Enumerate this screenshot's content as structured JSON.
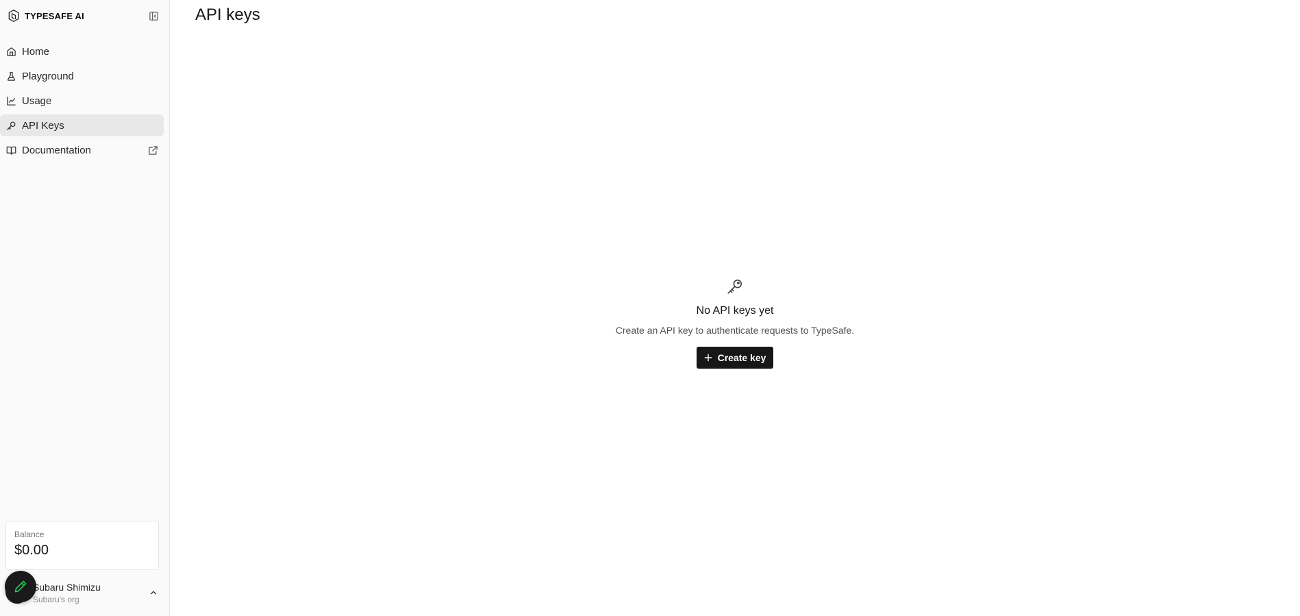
{
  "brand": {
    "name": "TYPESAFE AI",
    "logo_icon": "hexagon-logo-icon",
    "collapse_icon": "sidebar-collapse-icon"
  },
  "sidebar": {
    "items": [
      {
        "label": "Home",
        "icon": "home-icon",
        "active": false
      },
      {
        "label": "Playground",
        "icon": "flask-icon",
        "active": false
      },
      {
        "label": "Usage",
        "icon": "line-chart-icon",
        "active": false
      },
      {
        "label": "API Keys",
        "icon": "key-icon",
        "active": true
      },
      {
        "label": "Documentation",
        "icon": "book-icon",
        "active": false,
        "external": true
      }
    ]
  },
  "balance": {
    "label": "Balance",
    "value": "$0.00"
  },
  "user": {
    "name": "Subaru Shimizu",
    "org": "Subaru's org"
  },
  "main": {
    "title": "API keys",
    "empty": {
      "icon": "key-icon",
      "title": "No API keys yet",
      "description": "Create an API key to authenticate requests to TypeSafe.",
      "button_label": "Create key"
    }
  },
  "colors": {
    "sidebar_bg": "#fafafa",
    "active_item_bg": "#e8e8e8",
    "button_bg": "#171717",
    "fab_accent": "#22c55e"
  }
}
